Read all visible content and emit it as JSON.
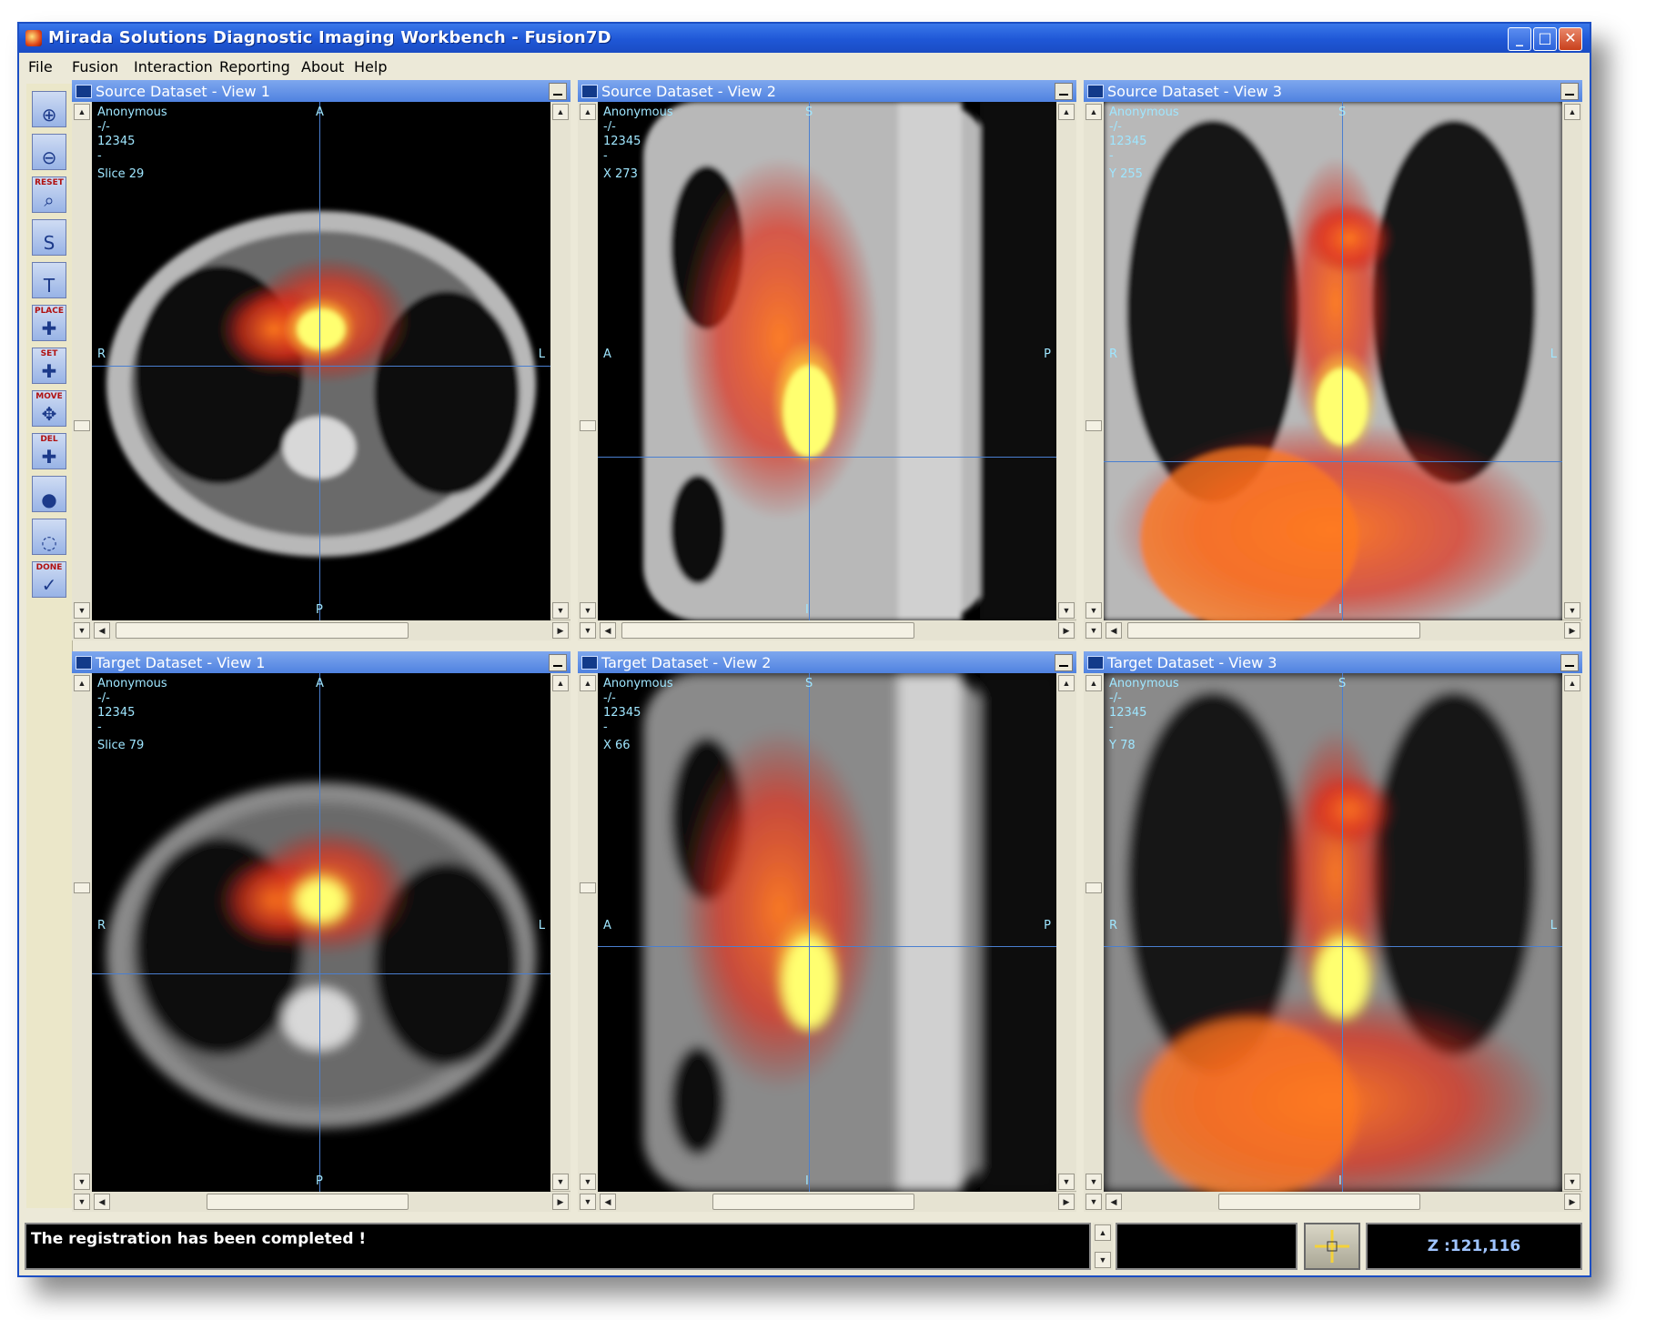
{
  "window": {
    "title": "Mirada Solutions Diagnostic Imaging Workbench - Fusion7D",
    "controls": [
      "_",
      "□",
      "✕"
    ]
  },
  "menu": [
    {
      "label": "File"
    },
    {
      "label": "Fusion"
    },
    {
      "label": "Interaction"
    },
    {
      "label": "Reporting"
    },
    {
      "label": "About"
    },
    {
      "label": "Help"
    }
  ],
  "toolbar": [
    {
      "name": "zoom-in",
      "label": "",
      "glyph": "⊕",
      "icon": "zoom-in-icon"
    },
    {
      "name": "zoom-out",
      "label": "",
      "glyph": "⊖",
      "icon": "zoom-out-icon"
    },
    {
      "name": "reset-zoom",
      "label": "RESET",
      "glyph": "⌕",
      "icon": "reset-zoom-icon"
    },
    {
      "name": "source",
      "label": "",
      "glyph": "S",
      "icon": "source-icon"
    },
    {
      "name": "target",
      "label": "",
      "glyph": "T",
      "icon": "target-icon"
    },
    {
      "name": "place",
      "label": "PLACE",
      "glyph": "✚",
      "icon": "place-landmark-icon"
    },
    {
      "name": "set",
      "label": "SET",
      "glyph": "✚",
      "icon": "set-landmark-icon"
    },
    {
      "name": "move",
      "label": "MOVE",
      "glyph": "✥",
      "icon": "move-landmark-icon"
    },
    {
      "name": "del",
      "label": "DEL",
      "glyph": "✚",
      "icon": "delete-landmark-icon"
    },
    {
      "name": "fusion",
      "label": "",
      "glyph": "●",
      "icon": "fusion-icon"
    },
    {
      "name": "lasso",
      "label": "",
      "glyph": "◌",
      "icon": "lasso-icon"
    },
    {
      "name": "done",
      "label": "DONE",
      "glyph": "✓",
      "icon": "done-icon"
    }
  ],
  "panels": [
    {
      "title": "Source Dataset - View 1",
      "lines": [
        "Anonymous",
        "-/-",
        "12345",
        "-",
        "Slice 29"
      ],
      "orient": {
        "top": "A",
        "bottom": "P",
        "left": "R",
        "right": "L"
      }
    },
    {
      "title": "Source Dataset - View 2",
      "lines": [
        "Anonymous",
        "-/-",
        "12345",
        "-",
        "X 273"
      ],
      "orient": {
        "top": "S",
        "bottom": "I",
        "left": "A",
        "right": "P"
      }
    },
    {
      "title": "Source Dataset - View 3",
      "lines": [
        "Anonymous",
        "-/-",
        "12345",
        "-",
        "Y 255"
      ],
      "orient": {
        "top": "S",
        "bottom": "I",
        "left": "R",
        "right": "L"
      }
    },
    {
      "title": "Target Dataset - View 1",
      "lines": [
        "Anonymous",
        "-/-",
        "12345",
        "-",
        "Slice 79"
      ],
      "orient": {
        "top": "A",
        "bottom": "P",
        "left": "R",
        "right": "L"
      }
    },
    {
      "title": "Target Dataset - View 2",
      "lines": [
        "Anonymous",
        "-/-",
        "12345",
        "-",
        "X 66"
      ],
      "orient": {
        "top": "S",
        "bottom": "I",
        "left": "A",
        "right": "P"
      }
    },
    {
      "title": "Target Dataset - View 3",
      "lines": [
        "Anonymous",
        "-/-",
        "12345",
        "-",
        "Y 78"
      ],
      "orient": {
        "top": "S",
        "bottom": "I",
        "left": "R",
        "right": "L"
      }
    }
  ],
  "status": {
    "message": "The registration has been completed !",
    "coordinates": "Z :121,116"
  },
  "colors": {
    "titlebar": "#1f57d6",
    "crosshair": "#4a7fd0",
    "overlay_text": "#9fe6ff",
    "hot_colormap": [
      "#ffff80",
      "#ff9a20",
      "#e0281c"
    ]
  }
}
